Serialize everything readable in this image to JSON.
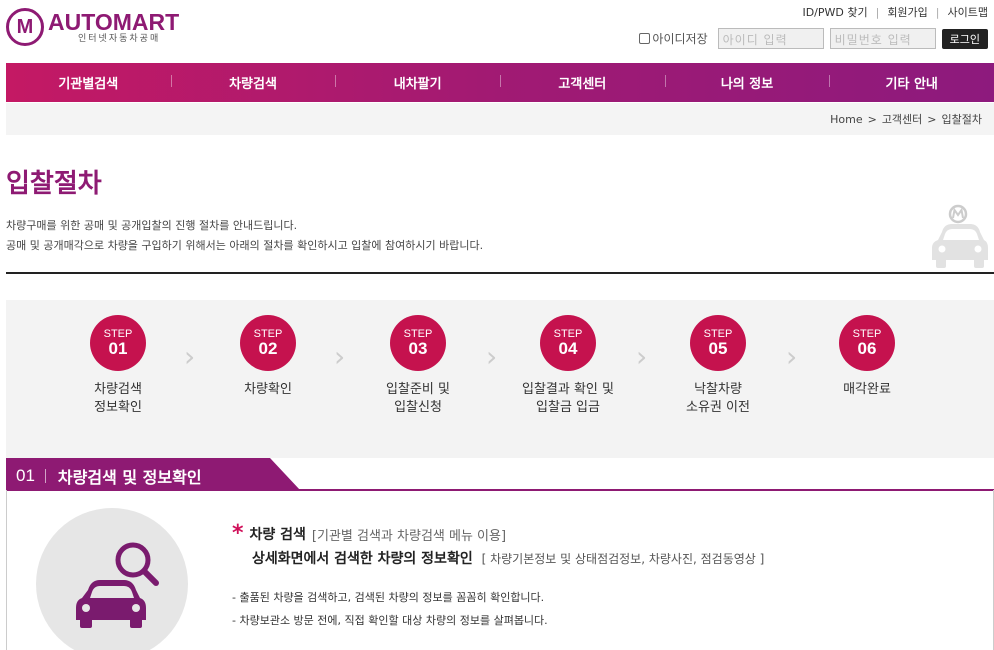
{
  "brand": {
    "logo_letter": "M",
    "name": "AUTOMART",
    "tagline": "인터넷자동차공매"
  },
  "top_links": [
    "ID/PWD 찾기",
    "회원가입",
    "사이트맵"
  ],
  "login": {
    "remember_label": "아이디저장",
    "id_placeholder": "아이디 입력",
    "pw_placeholder": "비밀번호 입력",
    "button": "로그인"
  },
  "nav": [
    "기관별검색",
    "차량검색",
    "내차팔기",
    "고객센터",
    "나의 정보",
    "기타 안내"
  ],
  "breadcrumb": [
    "Home",
    "고객센터",
    "입찰절차"
  ],
  "breadcrumb_sep": ">",
  "page": {
    "title": "입찰절차",
    "desc1": "차량구매를 위한 공매 및 공개입찰의 진행 절차를 안내드립니다.",
    "desc2": "공매 및 공개매각으로 차량을 구입하기 위해서는 아래의 절차를 확인하시고 입찰에 참여하시기 바랍니다."
  },
  "steps": [
    {
      "label": "STEP",
      "num": "01",
      "line1": "차량검색",
      "line2": "정보확인"
    },
    {
      "label": "STEP",
      "num": "02",
      "line1": "차량확인",
      "line2": ""
    },
    {
      "label": "STEP",
      "num": "03",
      "line1": "입찰준비 및",
      "line2": "입찰신청"
    },
    {
      "label": "STEP",
      "num": "04",
      "line1": "입찰결과 확인 및",
      "line2": "입찰금 입금"
    },
    {
      "label": "STEP",
      "num": "05",
      "line1": "낙찰차량",
      "line2": "소유권 이전"
    },
    {
      "label": "STEP",
      "num": "06",
      "line1": "매각완료",
      "line2": ""
    }
  ],
  "section": {
    "num": "01",
    "title": "차량검색 및 정보확인",
    "item_title": "차량 검색",
    "item_bracket": "[기관별 검색과 차량검색 메뉴 이용]",
    "item_sub": "상세화면에서 검색한 차량의 정보확인",
    "item_sub_bracket": "[ 차량기본정보 및 상태점검정보, 차량사진, 점검동영상 ]",
    "bullet1": "- 출품된 차량을 검색하고, 검색된 차량의 정보를 꼼꼼히 확인합니다.",
    "bullet2": "- 차량보관소 방문 전에, 직접 확인할 대상 차량의 정보를 살펴봅니다."
  },
  "colors": {
    "brand": "#8e1a73",
    "step": "#c5124e",
    "nav_start": "#c41964",
    "nav_end": "#8d1a7d"
  }
}
